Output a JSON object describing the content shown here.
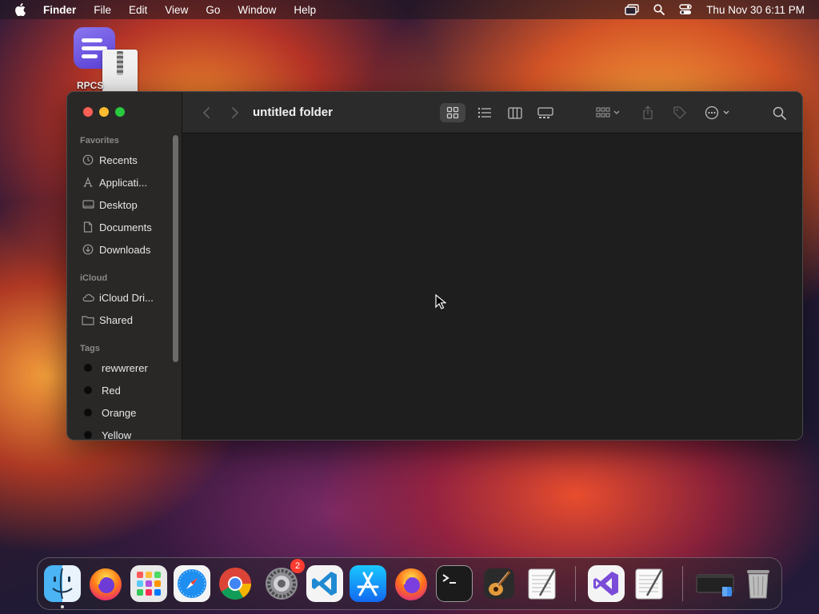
{
  "menubar": {
    "app_name": "Finder",
    "items": [
      "File",
      "Edit",
      "View",
      "Go",
      "Window",
      "Help"
    ],
    "datetime": "Thu Nov 30  6:11 PM"
  },
  "desktop": {
    "item_label": "RPCS"
  },
  "finder": {
    "title": "untitled folder",
    "sidebar": {
      "favorites_header": "Favorites",
      "favorites": [
        "Recents",
        "Applicati...",
        "Desktop",
        "Documents",
        "Downloads"
      ],
      "icloud_header": "iCloud",
      "icloud": [
        "iCloud Dri...",
        "Shared"
      ],
      "tags_header": "Tags",
      "tags": [
        "rewwrerer",
        "Red",
        "Orange",
        "Yellow"
      ]
    }
  },
  "dock": {
    "settings_badge": "2"
  },
  "colors": {
    "accent": "#28c840",
    "close": "#fe5f57",
    "minimize": "#febc2e",
    "badge": "#ff3b30"
  }
}
